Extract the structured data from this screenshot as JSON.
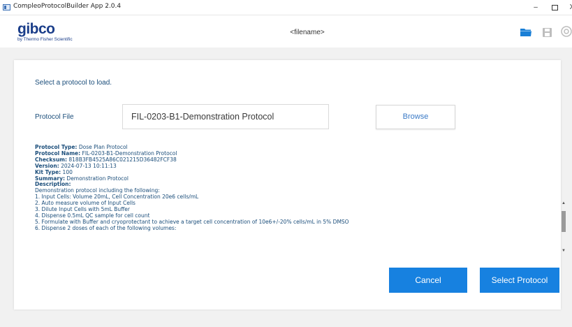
{
  "window": {
    "title": "CompleoProtocolBuilder App 2.0.4",
    "minimize": "–",
    "close": "X"
  },
  "header": {
    "logo_main": "gibco",
    "logo_sub": "by Thermo Fisher Scientific",
    "filename": "<filename>"
  },
  "dialog": {
    "prompt": "Select a protocol to load.",
    "file_label": "Protocol File",
    "file_value": "FIL-0203-B1-Demonstration Protocol",
    "browse_label": "Browse",
    "cancel_label": "Cancel",
    "select_label": "Select Protocol"
  },
  "details": {
    "protocol_type_key": "Protocol Type:",
    "protocol_type_val": "Dose Plan Protocol",
    "protocol_name_key": "Protocol Name:",
    "protocol_name_val": "FIL-0203-B1-Demonstration Protocol",
    "checksum_key": "Checksum:",
    "checksum_val": "818B3FB4525A86C021215D36482FCF38",
    "version_key": "Version:",
    "version_val": "2024-07-13 10:11:13",
    "kit_type_key": "Kit Type:",
    "kit_type_val": "100",
    "summary_key": "Summary:",
    "summary_val": "Demonstration Protocol",
    "description_key": "Description:",
    "lines": [
      "Demonstration protocol including the following:",
      "1. Input Cells: Volume 20mL, Cell Concentration 20e6 cells/mL",
      "2. Auto measure volume of Input Cells",
      "3. Dilute Input Cells with 5mL Buffer",
      "4. Dispense 0.5mL QC sample for cell count",
      "5. Formulate with Buffer and cryoprotectant to achieve a target cell concentration of 10e6+/-20% cells/mL in 5% DMSO",
      "6. Dispense 2 doses of each of the following volumes:"
    ]
  },
  "icons": {
    "folder": "folder-icon",
    "save": "save-icon",
    "extra": "gear-icon"
  },
  "colors": {
    "accent": "#1781e0",
    "label_text": "#1a4d7a",
    "brand": "#1b3e8a"
  }
}
